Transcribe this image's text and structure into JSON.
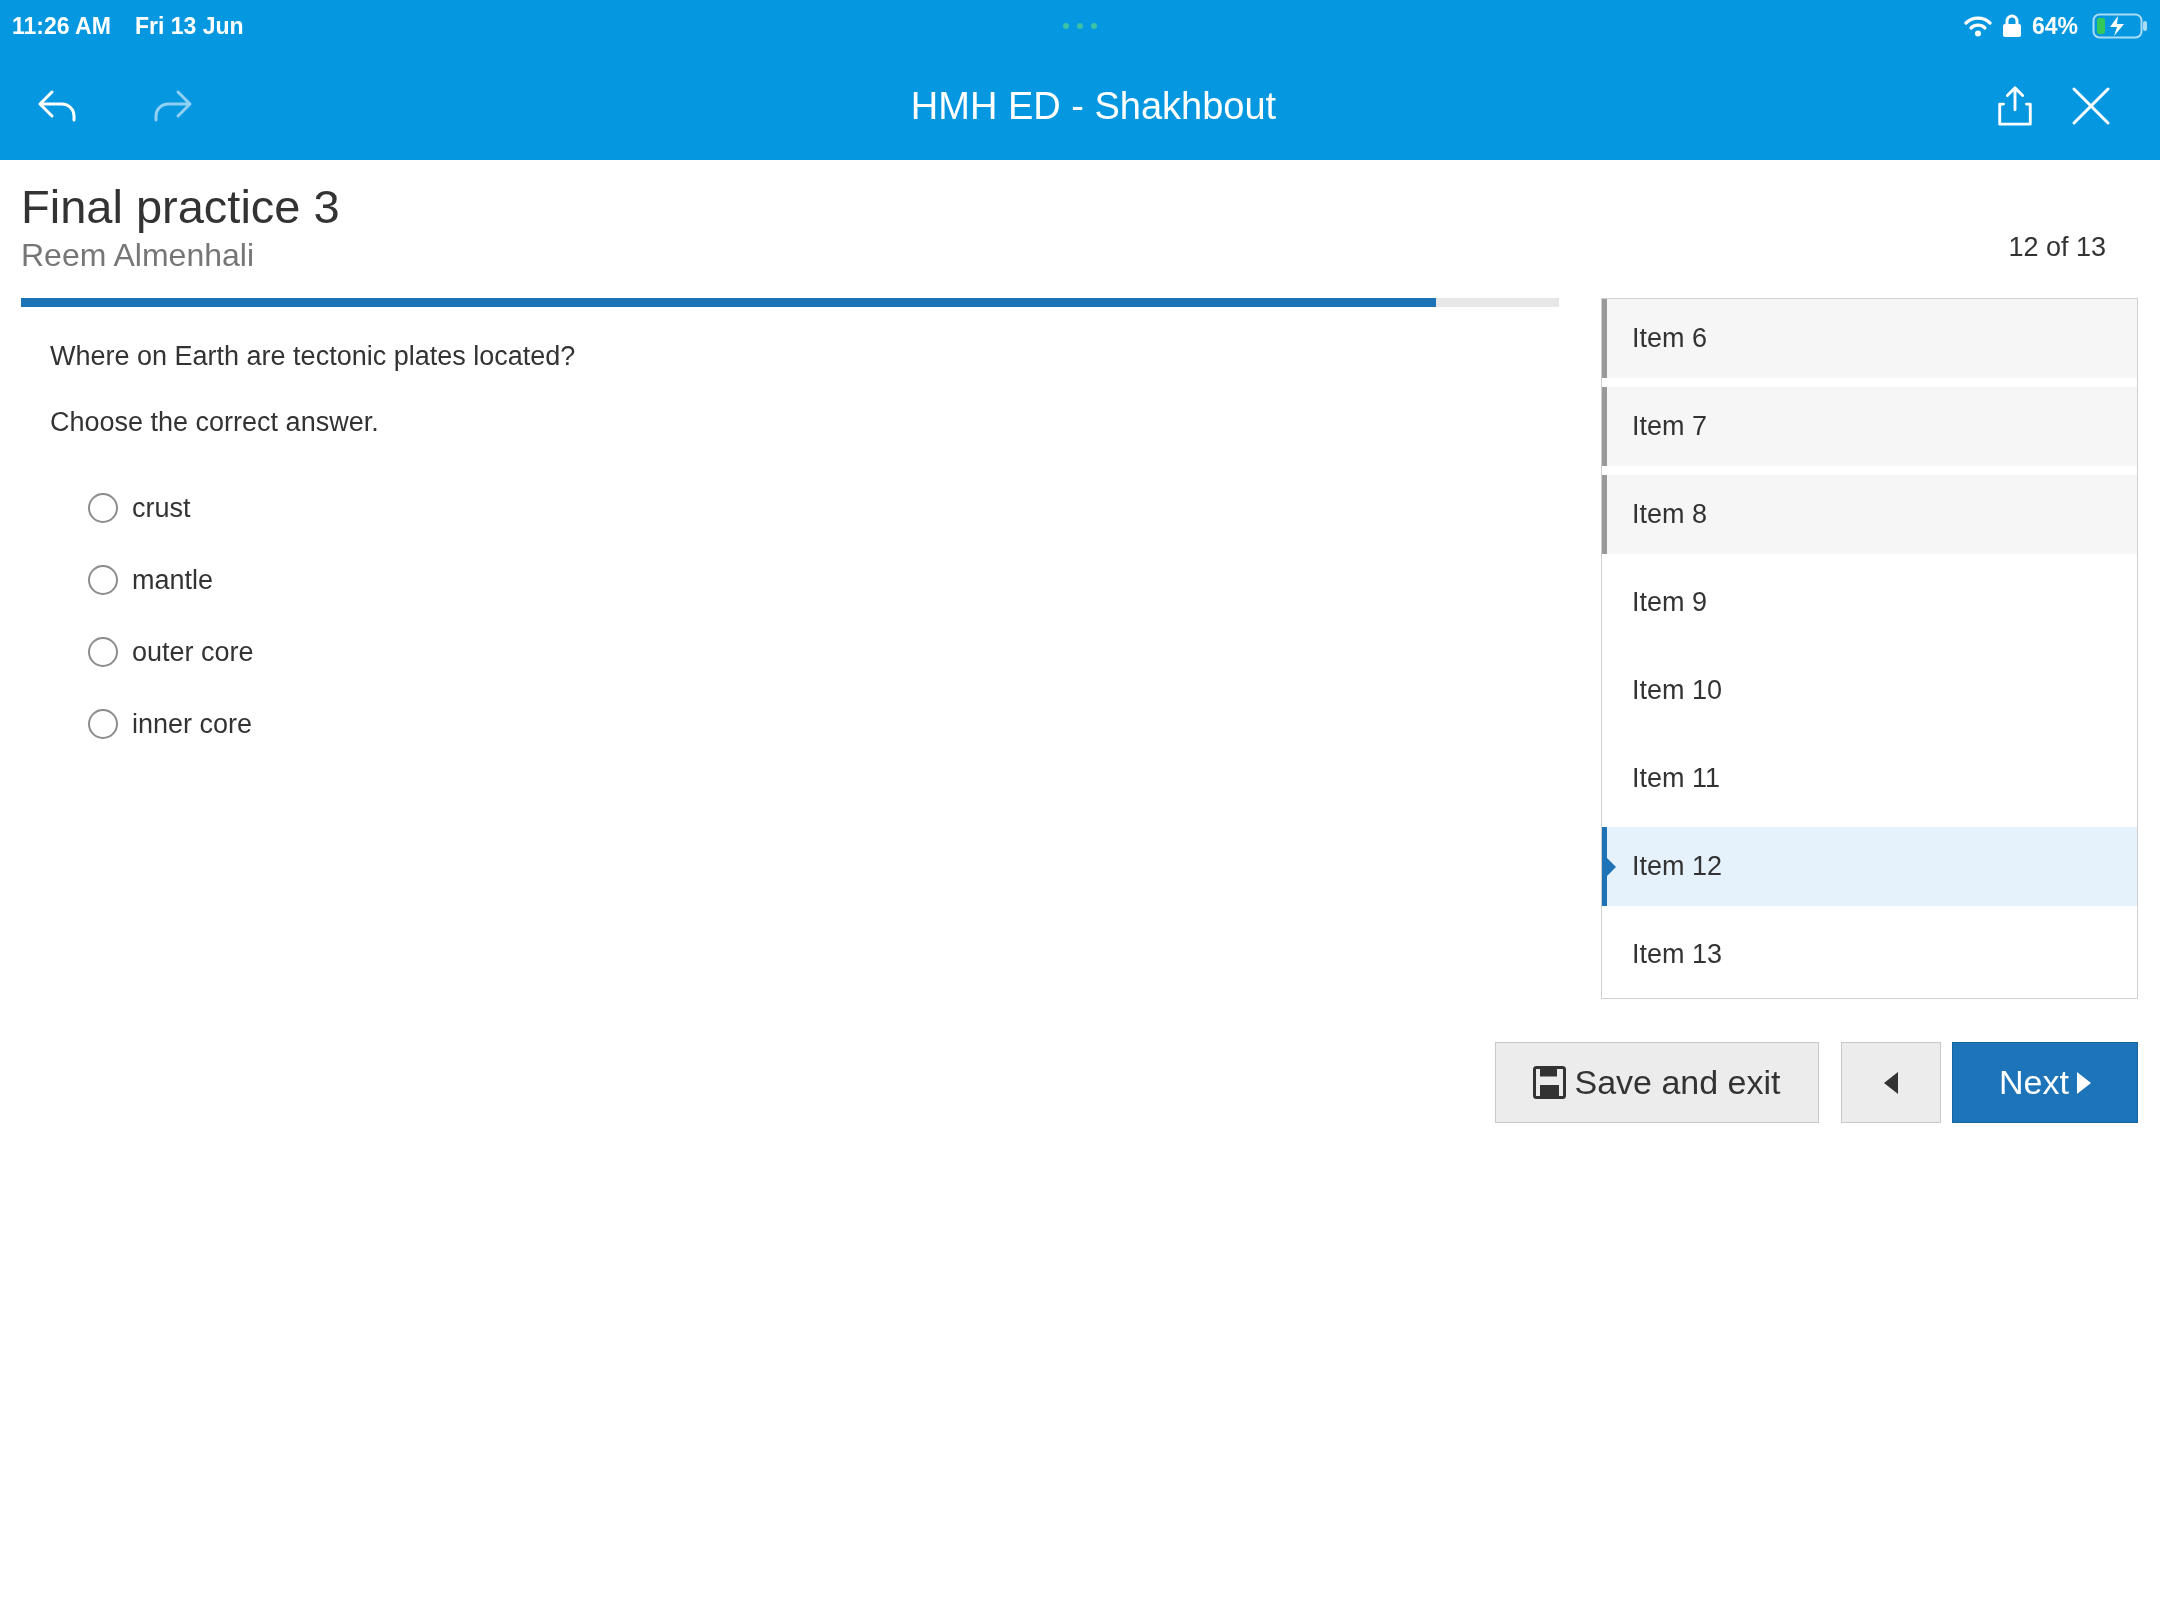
{
  "status_bar": {
    "time": "11:26 AM",
    "date": "Fri 13 Jun",
    "battery": "64%"
  },
  "nav_bar": {
    "title": "HMH ED - Shakhbout",
    "left_actions": [
      {
        "kind": "back",
        "disabled": false
      },
      {
        "kind": "forward",
        "disabled": true
      }
    ],
    "right_actions": [
      {
        "kind": "share",
        "disabled": false
      },
      {
        "kind": "close",
        "disabled": false
      }
    ]
  },
  "assignment": {
    "title": "Final practice 3",
    "student": "Reem Almenhali",
    "position": "12 of 13"
  },
  "progress": {
    "level": 0.92
  },
  "question": {
    "prompt": "Where on Earth are tectonic plates located?",
    "instruction": "Choose the correct answer.",
    "options": [
      {
        "label": "crust",
        "selected": false
      },
      {
        "label": "mantle",
        "selected": false
      },
      {
        "label": "outer core",
        "selected": false
      },
      {
        "label": "inner core",
        "selected": false
      }
    ]
  },
  "items": [
    {
      "label": "Item 6",
      "answered": true,
      "selected": false
    },
    {
      "label": "Item 7",
      "answered": true,
      "selected": false
    },
    {
      "label": "Item 8",
      "answered": true,
      "selected": false
    },
    {
      "label": "Item 9",
      "answered": false,
      "selected": false
    },
    {
      "label": "Item 10",
      "answered": false,
      "selected": false
    },
    {
      "label": "Item 11",
      "answered": false,
      "selected": false
    },
    {
      "label": "Item 12",
      "answered": false,
      "selected": true
    },
    {
      "label": "Item 13",
      "answered": false,
      "selected": false
    }
  ],
  "buttons": [
    {
      "kind": "save",
      "label": "Save and exit"
    },
    {
      "kind": "previous"
    },
    {
      "kind": "next",
      "label": "Next"
    }
  ]
}
